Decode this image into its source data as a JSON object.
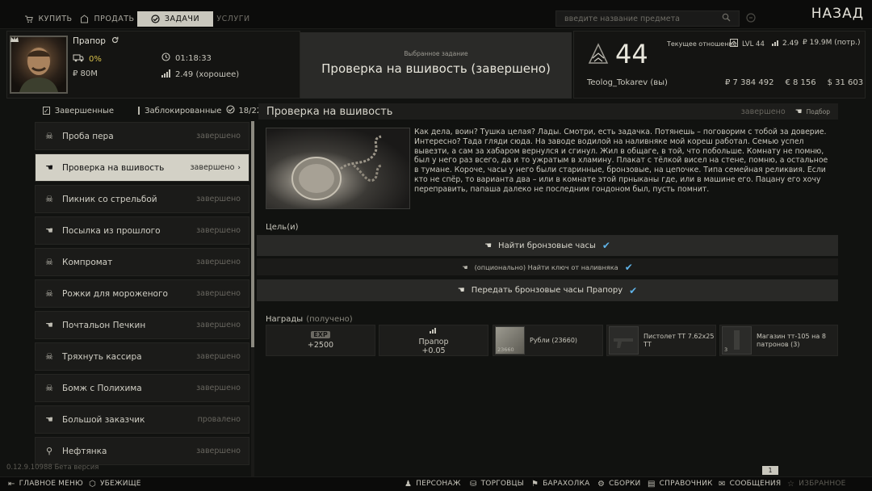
{
  "top_tabs": {
    "buy": "КУПИТЬ",
    "sell": "ПРОДАТЬ",
    "tasks": "ЗАДАЧИ",
    "services": "УСЛУГИ"
  },
  "search": {
    "placeholder": "введите название предмета"
  },
  "back_label": "НАЗАД",
  "trader": {
    "name": "Прапор",
    "loyalty": "0%",
    "timer": "01:18:33",
    "money": "₽ 80M",
    "standing": "2.49 (хорошее)"
  },
  "selected_quest": {
    "label": "Выбранное задание",
    "title": "Проверка на вшивость (завершено)"
  },
  "player": {
    "level": "44",
    "name": "Teolog_Tokarev (вы)",
    "relation_label": "Текущее отношение",
    "lvl": "LVL 44",
    "relation_standing": "2.49",
    "relation_sales": "₽ 19.9M (потр.)",
    "rub": "₽ 7 384 492",
    "eur": "€ 8 156",
    "usd": "$ 31 603"
  },
  "filters": {
    "completed": "Завершенные",
    "locked": "Заблокированные",
    "count": "18/22"
  },
  "quests": [
    {
      "name": "Проба пера",
      "status": "завершено",
      "icon": "skull-icon"
    },
    {
      "name": "Проверка на вшивость",
      "status": "завершено",
      "icon": "hand-icon",
      "active": true
    },
    {
      "name": "Пикник со стрельбой",
      "status": "завершено",
      "icon": "skull-icon"
    },
    {
      "name": "Посылка из прошлого",
      "status": "завершено",
      "icon": "hand-icon"
    },
    {
      "name": "Компромат",
      "status": "завершено",
      "icon": "skull-icon"
    },
    {
      "name": "Рожки для мороженого",
      "status": "завершено",
      "icon": "skull-icon"
    },
    {
      "name": "Почтальон Печкин",
      "status": "завершено",
      "icon": "hand-icon"
    },
    {
      "name": "Тряхнуть кассира",
      "status": "завершено",
      "icon": "skull-icon"
    },
    {
      "name": "Бомж с Полихима",
      "status": "завершено",
      "icon": "skull-icon"
    },
    {
      "name": "Большой заказчик",
      "status": "провалено",
      "icon": "hand-icon"
    },
    {
      "name": "Нефтянка",
      "status": "завершено",
      "icon": "pin-icon"
    }
  ],
  "main": {
    "title": "Проверка на вшивость",
    "status": "завершено",
    "handbook": "Подбор",
    "description": "Как дела, воин? Тушка целая? Лады. Смотри, есть задачка. Потянешь – поговорим с тобой за доверие. Интересно? Тада гляди сюда. На заводе водилой на наливняке мой кореш работал. Семью успел вывезти, а сам за хабаром вернулся и сгинул. Жил в общаге, в той, что побольше. Комнату не помню, был у него раз всего, да и то ужратым в хламину. Плакат с тёлкой висел на стене, помню, а остальное в тумане. Короче, часы у него были старинные, бронзовые, на цепочке. Типа семейная реликвия. Если кто не спёр, то варианта два – или в комнате этой прныканы где, или в машине его. Пацану его хочу переправить, папаша далеко не последним гондоном был, пусть помнит.",
    "goals_label": "Цель(и)",
    "goals": [
      "Найти бронзовые часы",
      "(опционально) Найти ключ от наливняка",
      "Передать бронзовые часы Прапору"
    ],
    "rewards_label": "Награды",
    "rewards_status": "(получено)",
    "rewards": {
      "exp_badge": "EXP",
      "exp_value": "+2500",
      "trader_name": "Прапор",
      "trader_value": "+0.05",
      "rub_count": "23660",
      "rub_label": "Рубли (23660)",
      "pistol_label": "Пистолет ТТ 7.62x25 ТТ",
      "mag_count": "3",
      "mag_label": "Магазин тт-105 на 8 патронов (3)"
    }
  },
  "version": "0.12.9.10988 Бета версия",
  "page_indicator": "1",
  "bottom_nav": {
    "main_menu": "ГЛАВНОЕ МЕНЮ",
    "hideout": "УБЕЖИЩЕ",
    "character": "ПЕРСОНАЖ",
    "traders": "ТОРГОВЦЫ",
    "flea": "БАРАХОЛКА",
    "builds": "СБОРКИ",
    "handbook": "СПРАВОЧНИК",
    "messages": "СООБЩЕНИЯ",
    "favorites": "ИЗБРАННОЕ"
  }
}
